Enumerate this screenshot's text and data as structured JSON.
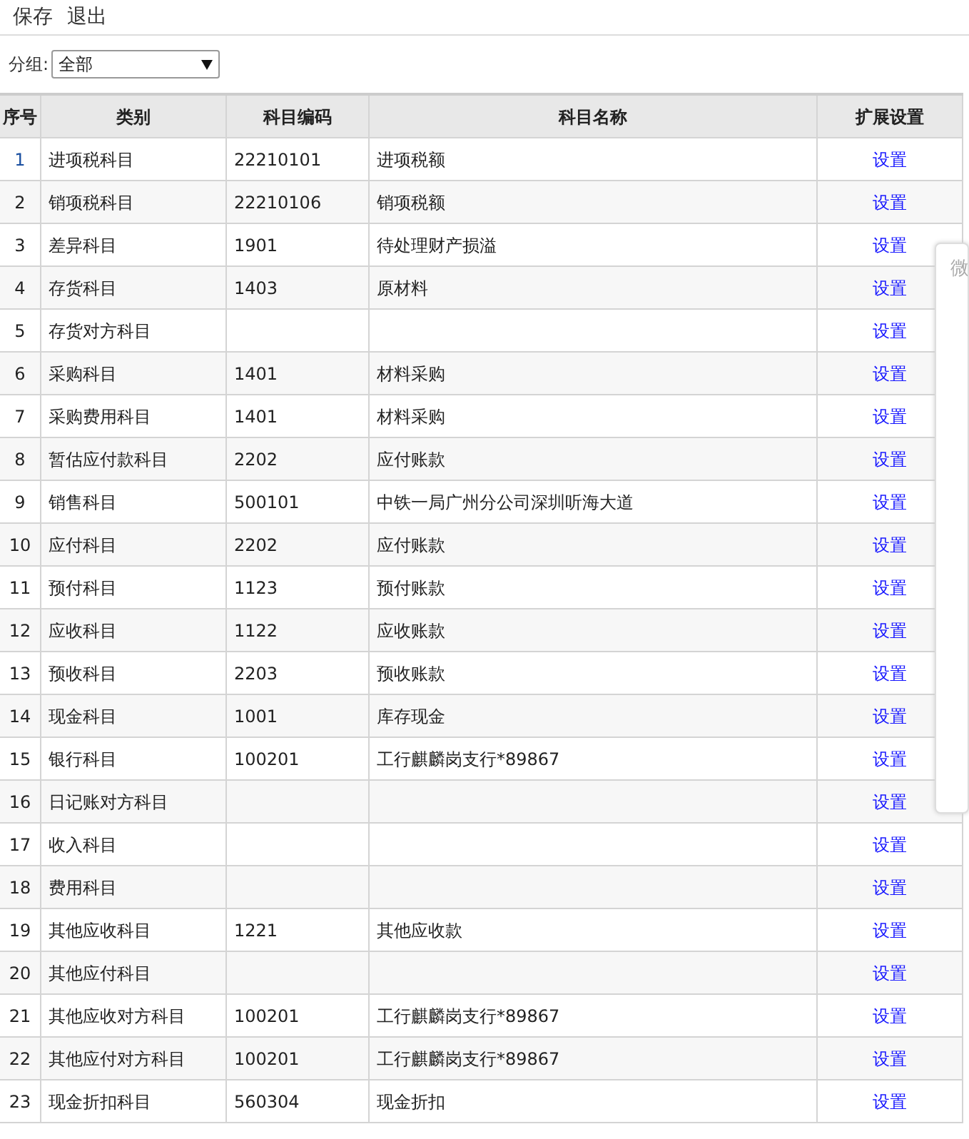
{
  "toolbar": {
    "buttons": [
      "保存",
      "退出"
    ]
  },
  "filter": {
    "label": "分组:",
    "value": "全部"
  },
  "table": {
    "columns": [
      "序号",
      "类别",
      "科目编码",
      "科目名称",
      "扩展设置"
    ],
    "rows": [
      {
        "no": "1",
        "category": "进项税科目",
        "code": "22210101",
        "name": "进项税额",
        "action": "设置",
        "selected": true
      },
      {
        "no": "2",
        "category": "销项税科目",
        "code": "22210106",
        "name": "销项税额",
        "action": "设置",
        "selected": false
      },
      {
        "no": "3",
        "category": "差异科目",
        "code": "1901",
        "name": "待处理财产损溢",
        "action": "设置",
        "selected": false
      },
      {
        "no": "4",
        "category": "存货科目",
        "code": "1403",
        "name": "原材料",
        "action": "设置",
        "selected": false
      },
      {
        "no": "5",
        "category": "存货对方科目",
        "action": "设置",
        "selected": false
      },
      {
        "no": "6",
        "category": "采购科目",
        "code": "1401",
        "name": "材料采购",
        "action": "设置",
        "selected": false
      },
      {
        "no": "7",
        "category": "采购费用科目",
        "code": "1401",
        "name": "材料采购",
        "action": "设置",
        "selected": false
      },
      {
        "no": "8",
        "category": "暂估应付款科目",
        "code": "2202",
        "name": "应付账款",
        "action": "设置",
        "selected": false
      },
      {
        "no": "9",
        "category": "销售科目",
        "code": "500101",
        "name": "中铁一局广州分公司深圳听海大道",
        "action": "设置",
        "selected": false
      },
      {
        "no": "10",
        "category": "应付科目",
        "code": "2202",
        "name": "应付账款",
        "action": "设置",
        "selected": false
      },
      {
        "no": "11",
        "category": "预付科目",
        "code": "1123",
        "name": "预付账款",
        "action": "设置",
        "selected": false
      },
      {
        "no": "12",
        "category": "应收科目",
        "code": "1122",
        "name": "应收账款",
        "action": "设置",
        "selected": false
      },
      {
        "no": "13",
        "category": "预收科目",
        "code": "2203",
        "name": "预收账款",
        "action": "设置",
        "selected": false
      },
      {
        "no": "14",
        "category": "现金科目",
        "code": "1001",
        "name": "库存现金",
        "action": "设置",
        "selected": false
      },
      {
        "no": "15",
        "category": "银行科目",
        "code": "100201",
        "name": "工行麒麟岗支行*89867",
        "action": "设置",
        "selected": false
      },
      {
        "no": "16",
        "category": "日记账对方科目",
        "action": "设置",
        "selected": false
      },
      {
        "no": "17",
        "category": "收入科目",
        "action": "设置",
        "selected": false
      },
      {
        "no": "18",
        "category": "费用科目",
        "action": "设置",
        "selected": false
      },
      {
        "no": "19",
        "category": "其他应收科目",
        "code": "1221",
        "name": "其他应收款",
        "action": "设置",
        "selected": false
      },
      {
        "no": "20",
        "category": "其他应付科目",
        "action": "设置",
        "selected": false
      },
      {
        "no": "21",
        "category": "其他应收对方科目",
        "code": "100201",
        "name": "工行麒麟岗支行*89867",
        "action": "设置",
        "selected": false
      },
      {
        "no": "22",
        "category": "其他应付对方科目",
        "code": "100201",
        "name": "工行麒麟岗支行*89867",
        "action": "设置",
        "selected": false
      },
      {
        "no": "23",
        "category": "现金折扣科目",
        "code": "560304",
        "name": "现金折扣",
        "action": "设置",
        "selected": false
      }
    ]
  },
  "side_panel": {
    "label": "微"
  }
}
